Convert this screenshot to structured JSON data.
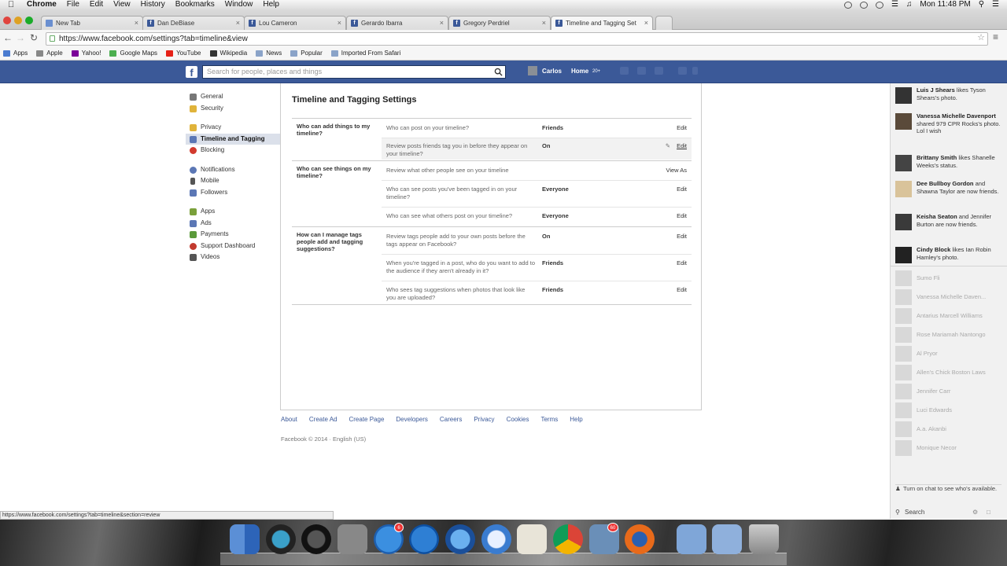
{
  "menubar": {
    "apple": "",
    "items": [
      "Chrome",
      "File",
      "Edit",
      "View",
      "History",
      "Bookmarks",
      "Window",
      "Help"
    ],
    "clock": "Mon 11:48 PM"
  },
  "tabs": [
    {
      "title": "New Tab"
    },
    {
      "title": "Dan DeBiase"
    },
    {
      "title": "Lou Cameron"
    },
    {
      "title": "Gerardo Ibarra"
    },
    {
      "title": "Gregory Perdriel"
    },
    {
      "title": "Timeline and Tagging Set"
    }
  ],
  "address": {
    "url": "https://www.facebook.com/settings?tab=timeline&view"
  },
  "bookmarks": [
    {
      "label": "Apps",
      "color": "#4a7bd0"
    },
    {
      "label": "Apple",
      "color": "#888888"
    },
    {
      "label": "Yahoo!",
      "color": "#7b0099"
    },
    {
      "label": "Google Maps",
      "color": "#4caf50"
    },
    {
      "label": "YouTube",
      "color": "#e62117"
    },
    {
      "label": "Wikipedia",
      "color": "#333333"
    },
    {
      "label": "News",
      "color": "#8aa3c8"
    },
    {
      "label": "Popular",
      "color": "#8aa3c8"
    },
    {
      "label": "Imported From Safari",
      "color": "#8aa3c8"
    }
  ],
  "fb": {
    "search_placeholder": "Search for people, places and things",
    "user": "Carlos",
    "home": "Home",
    "home_count": "20+"
  },
  "leftnav": [
    {
      "label": "General",
      "color": "#777777"
    },
    {
      "label": "Security",
      "color": "#e0b33a"
    },
    {
      "label": "Privacy",
      "color": "#e0b33a"
    },
    {
      "label": "Timeline and Tagging",
      "color": "#5b77b5"
    },
    {
      "label": "Blocking",
      "color": "#d23a2e"
    },
    {
      "label": "Notifications",
      "color": "#5b77b5"
    },
    {
      "label": "Mobile",
      "color": "#555555"
    },
    {
      "label": "Followers",
      "color": "#5b77b5"
    },
    {
      "label": "Apps",
      "color": "#7aa03a"
    },
    {
      "label": "Ads",
      "color": "#5b77b5"
    },
    {
      "label": "Payments",
      "color": "#5b9a3a"
    },
    {
      "label": "Support Dashboard",
      "color": "#c23a2e"
    },
    {
      "label": "Videos",
      "color": "#555555"
    }
  ],
  "settings": {
    "title": "Timeline and Tagging Settings",
    "sections": [
      {
        "title": "Who can add things to my timeline?",
        "rows": [
          {
            "question": "Who can post on your timeline?",
            "value": "Friends",
            "action": "Edit"
          },
          {
            "question": "Review posts friends tag you in before they appear on your timeline?",
            "value": "On",
            "action": "Edit"
          }
        ]
      },
      {
        "title": "Who can see things on my timeline?",
        "rows": [
          {
            "question": "Review what other people see on your timeline",
            "value": "",
            "action": "View As"
          },
          {
            "question": "Who can see posts you've been tagged in on your timeline?",
            "value": "Everyone",
            "action": "Edit"
          },
          {
            "question": "Who can see what others post on your timeline?",
            "value": "Everyone",
            "action": "Edit"
          }
        ]
      },
      {
        "title": "How can I manage tags people add and tagging suggestions?",
        "rows": [
          {
            "question": "Review tags people add to your own posts before the tags appear on Facebook?",
            "value": "On",
            "action": "Edit"
          },
          {
            "question": "When you're tagged in a post, who do you want to add to the audience if they aren't already in it?",
            "value": "Friends",
            "action": "Edit"
          },
          {
            "question": "Who sees tag suggestions when photos that look like you are uploaded?",
            "value": "Friends",
            "action": "Edit"
          }
        ]
      }
    ]
  },
  "footer": {
    "links": [
      "About",
      "Create Ad",
      "Create Page",
      "Developers",
      "Careers",
      "Privacy",
      "Cookies",
      "Terms",
      "Help"
    ],
    "copyright": "Facebook © 2014 · English (US)"
  },
  "ticker": [
    {
      "name": "Luis J Shears",
      "text": " likes Tyson Shears's photo."
    },
    {
      "name": "Vanessa Michelle Davenport",
      "text": " shared 979 CPR Rocks's photo. Lol I wish"
    },
    {
      "name": "Brittany Smith",
      "text": " likes Shanelle Weeks's status."
    },
    {
      "name": "Dee Bullboy Gordon",
      "text": " and Shawna Taylor are now friends."
    },
    {
      "name": "Keisha Seaton",
      "text": " and Jennifer Burton are now friends."
    },
    {
      "name": "Cindy Block",
      "text": " likes Ian Robin Hamley's photo."
    }
  ],
  "chat_contacts": [
    "Sumo Fli",
    "Vanessa Michelle Daven...",
    "Antarius Marcell Williams",
    "Rose Mariamah Nantongo",
    "Al Pryor",
    "Allen's Chick Boston Laws",
    "Jennifer Carr",
    "Luci Edwards",
    "A.a. Akanbi",
    "Monique Necor"
  ],
  "chat": {
    "notice": "Turn on chat to see who's available.",
    "search": "Search"
  },
  "statusbar": {
    "text": "https://www.facebook.com/settings?tab=timeline&section=review"
  },
  "dock": {
    "appstore_badge": "6",
    "mail_badge": "60"
  }
}
